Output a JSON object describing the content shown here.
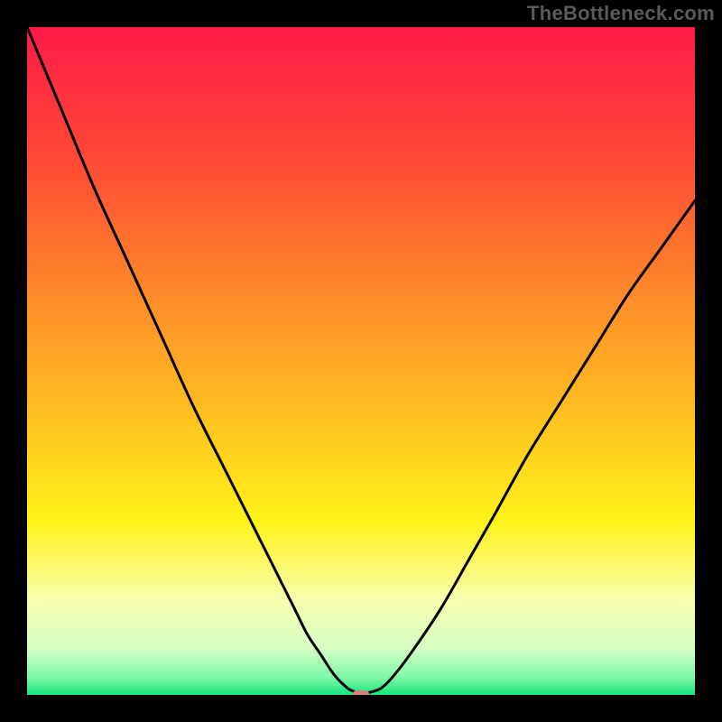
{
  "watermark": "TheBottleneck.com",
  "chart_data": {
    "type": "line",
    "title": "",
    "xlabel": "",
    "ylabel": "",
    "xlim": [
      0,
      100
    ],
    "ylim": [
      0,
      100
    ],
    "gradient": [
      {
        "offset": 0.0,
        "color": "#ff1a48"
      },
      {
        "offset": 0.2,
        "color": "#ff4a35"
      },
      {
        "offset": 0.4,
        "color": "#ff8a2a"
      },
      {
        "offset": 0.58,
        "color": "#ffc021"
      },
      {
        "offset": 0.74,
        "color": "#fff21a"
      },
      {
        "offset": 0.86,
        "color": "#f7ffb0"
      },
      {
        "offset": 0.93,
        "color": "#d6ffc4"
      },
      {
        "offset": 0.975,
        "color": "#7bf7a5"
      },
      {
        "offset": 1.0,
        "color": "#17e47a"
      }
    ],
    "series": [
      {
        "name": "bottleneck-curve",
        "x": [
          0,
          5,
          10,
          15,
          20,
          25,
          30,
          35,
          40,
          42,
          44,
          46,
          48,
          49,
          50,
          51,
          53,
          55,
          58,
          62,
          66,
          70,
          75,
          80,
          85,
          90,
          95,
          100
        ],
        "y": [
          100,
          88,
          76,
          65,
          54,
          43,
          33,
          23,
          13,
          9,
          6,
          3,
          1,
          0.5,
          0,
          0.3,
          1,
          3,
          7,
          13,
          20,
          27,
          36,
          44,
          52,
          60,
          67,
          74
        ]
      }
    ],
    "marker": {
      "x": 50,
      "y": 0,
      "w": 2.4,
      "h": 1.4
    }
  }
}
